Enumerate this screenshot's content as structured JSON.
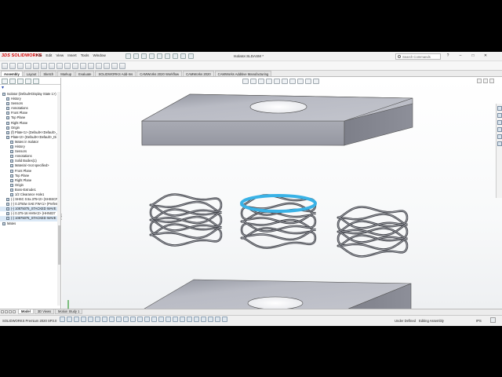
{
  "app": {
    "brand": "SOLIDWORKS",
    "brand_prefix": "3DS",
    "document_title": "Isolator.SLDASM *"
  },
  "menu": [
    "File",
    "Edit",
    "View",
    "Insert",
    "Tools",
    "Window"
  ],
  "search": {
    "placeholder": "Search Commands"
  },
  "window_controls": [
    "?",
    "–",
    "□",
    "✕"
  ],
  "tabs": [
    "Assembly",
    "Layout",
    "Sketch",
    "Markup",
    "Evaluate",
    "SOLIDWORKS Add-Ins",
    "CAMWorks 2020 Workflow",
    "CAMWorks 2020",
    "CAMWorks Additive Manufacturing"
  ],
  "active_tab": "Assembly",
  "feature_tree": [
    {
      "label": "Isolator  (Default<Display State 1>)",
      "indent": 0,
      "icon": "assembly-icon"
    },
    {
      "label": "History",
      "indent": 1,
      "icon": "history-icon"
    },
    {
      "label": "Sensors",
      "indent": 1,
      "icon": "sensors-icon"
    },
    {
      "label": "Annotations",
      "indent": 1,
      "icon": "annotations-icon"
    },
    {
      "label": "Front Plane",
      "indent": 1,
      "icon": "plane-icon"
    },
    {
      "label": "Top Plane",
      "indent": 1,
      "icon": "plane-icon"
    },
    {
      "label": "Right Plane",
      "indent": 1,
      "icon": "plane-icon"
    },
    {
      "label": "Origin",
      "indent": 1,
      "icon": "origin-icon"
    },
    {
      "label": "(f) Plate<1> (Default<<Default>_",
      "indent": 1,
      "icon": "part-icon"
    },
    {
      "label": "Plate<2> (Default<<Default>_Di",
      "indent": 1,
      "icon": "part-icon"
    },
    {
      "label": "Mates in Isolator",
      "indent": 2,
      "icon": "mates-icon"
    },
    {
      "label": "History",
      "indent": 2,
      "icon": "history-icon"
    },
    {
      "label": "Sensors",
      "indent": 2,
      "icon": "sensors-icon"
    },
    {
      "label": "Annotations",
      "indent": 2,
      "icon": "annotations-icon"
    },
    {
      "label": "Solid Bodies(1)",
      "indent": 2,
      "icon": "solid-bodies-icon"
    },
    {
      "label": "Material <not specified>",
      "indent": 2,
      "icon": "material-icon"
    },
    {
      "label": "Front Plane",
      "indent": 2,
      "icon": "plane-icon"
    },
    {
      "label": "Top Plane",
      "indent": 2,
      "icon": "plane-icon"
    },
    {
      "label": "Right Plane",
      "indent": 2,
      "icon": "plane-icon"
    },
    {
      "label": "Origin",
      "indent": 2,
      "icon": "origin-icon"
    },
    {
      "label": "Boss-Extrude1",
      "indent": 2,
      "icon": "extrude-icon"
    },
    {
      "label": "1/2 Clearance Hole1",
      "indent": 2,
      "icon": "hole-icon"
    },
    {
      "label": "(-) SHSC 0.5x.375<2> (SHSSCREW",
      "indent": 1,
      "icon": "part-icon"
    },
    {
      "label": "(-) 0.3750w SAE FW<1> (Preferred",
      "indent": 1,
      "icon": "part-icon"
    },
    {
      "label": "(-) 10875075_STACKED WAVE SPR",
      "indent": 1,
      "icon": "part-icon",
      "highlight": true
    },
    {
      "label": "(-) 0.375-16 HHN<2> (HHN037",
      "indent": 1,
      "icon": "part-icon"
    },
    {
      "label": "(-) 10875075_STACKED WAVE SPR",
      "indent": 1,
      "icon": "part-icon",
      "highlight": true
    },
    {
      "label": "Mates",
      "indent": 0,
      "icon": "mates-icon"
    }
  ],
  "bottom_tabs": [
    "Model",
    "3D Views",
    "Motion Study 1"
  ],
  "active_bottom_tab": "Model",
  "status": {
    "product": "SOLIDWORKS Premium 2020 SP3.0",
    "definition": "Under Defined",
    "mode": "Editing Assembly",
    "units": "IPS"
  },
  "colors": {
    "plate_top": "#b4b6bf",
    "plate_front": "#9c9ea8",
    "plate_side": "#7f818b",
    "selection": "#39b2e6",
    "brand": "#d40000"
  }
}
